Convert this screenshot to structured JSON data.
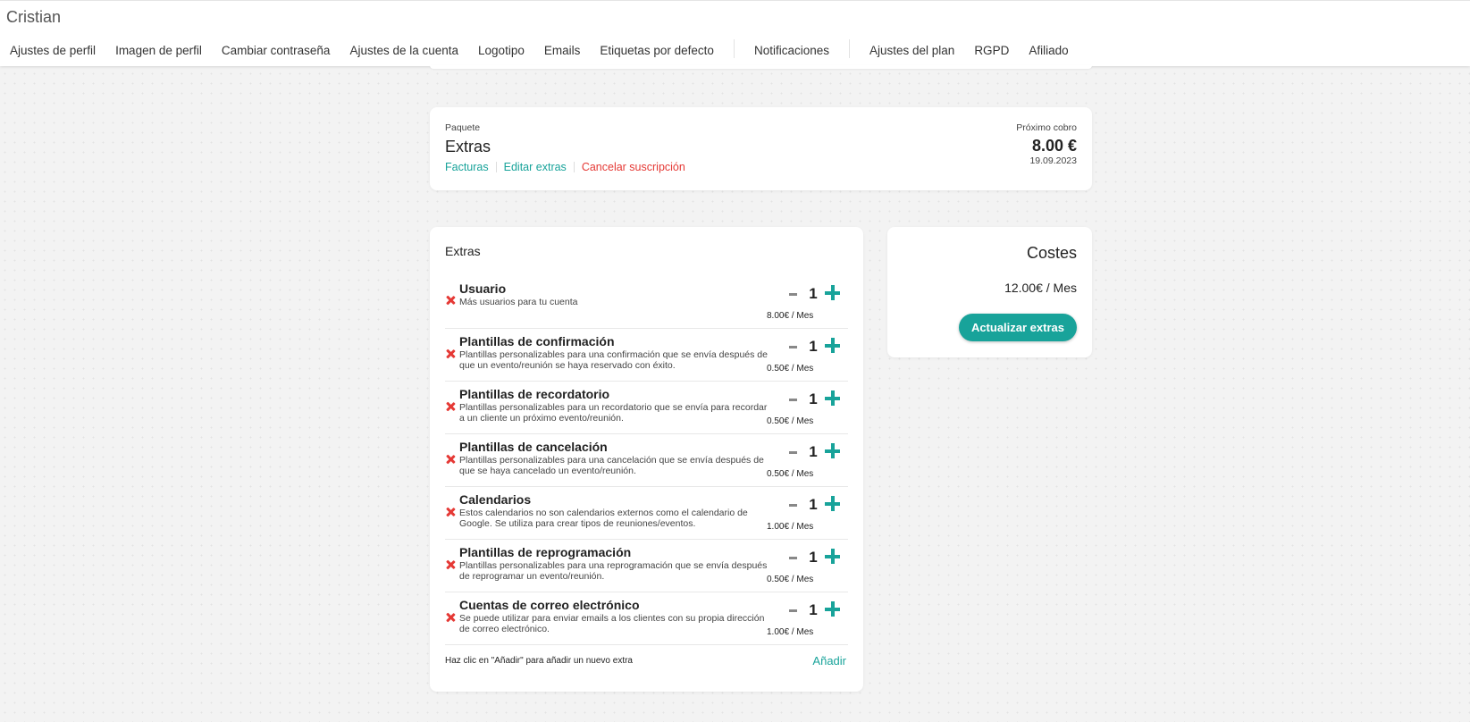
{
  "header": {
    "user_name": "Cristian",
    "tabs": [
      {
        "label": "Ajustes de perfil"
      },
      {
        "label": "Imagen de perfil"
      },
      {
        "label": "Cambiar contraseña"
      },
      {
        "label": "Ajustes de la cuenta"
      },
      {
        "label": "Logotipo"
      },
      {
        "label": "Emails"
      },
      {
        "label": "Etiquetas por defecto"
      },
      {
        "label": "Notificaciones"
      },
      {
        "label": "Ajustes del plan",
        "active": true
      },
      {
        "label": "RGPD"
      },
      {
        "label": "Afiliado"
      }
    ]
  },
  "package": {
    "label": "Paquete",
    "name": "Extras",
    "links": {
      "invoices": "Facturas",
      "edit": "Editar extras",
      "cancel": "Cancelar suscripción"
    },
    "next_label": "Próximo cobro",
    "next_amount": "8.00 €",
    "next_date": "19.09.2023"
  },
  "extras": {
    "title": "Extras",
    "items": [
      {
        "name": "Usuario",
        "description": "Más usuarios para tu cuenta",
        "quantity": "1",
        "price": "8.00€ / Mes"
      },
      {
        "name": "Plantillas de confirmación",
        "description": "Plantillas personalizables para una confirmación que se envía después de que un evento/reunión se haya reservado con éxito.",
        "quantity": "1",
        "price": "0.50€ / Mes"
      },
      {
        "name": "Plantillas de recordatorio",
        "description": "Plantillas personalizables para un recordatorio que se envía para recordar a un cliente un próximo evento/reunión.",
        "quantity": "1",
        "price": "0.50€ / Mes"
      },
      {
        "name": "Plantillas de cancelación",
        "description": "Plantillas personalizables para una cancelación que se envía después de que se haya cancelado un evento/reunión.",
        "quantity": "1",
        "price": "0.50€ / Mes"
      },
      {
        "name": "Calendarios",
        "description": "Estos calendarios no son calendarios externos como el calendario de Google. Se utiliza para crear tipos de reuniones/eventos.",
        "quantity": "1",
        "price": "1.00€ / Mes"
      },
      {
        "name": "Plantillas de reprogramación",
        "description": "Plantillas personalizables para una reprogramación que se envía después de reprogramar un evento/reunión.",
        "quantity": "1",
        "price": "0.50€ / Mes"
      },
      {
        "name": "Cuentas de correo electrónico",
        "description": "Se puede utilizar para enviar emails a los clientes con su propia dirección de correo electrónico.",
        "quantity": "1",
        "price": "1.00€ / Mes"
      }
    ],
    "footer_hint": "Haz clic en \"Añadir\" para añadir un nuevo extra",
    "add_label": "Añadir"
  },
  "costs": {
    "title": "Costes",
    "amount": "12.00€ / Mes",
    "update_button": "Actualizar extras"
  },
  "colors": {
    "accent": "#18a39a",
    "danger": "#e53935"
  },
  "icons": {
    "remove": "close-icon",
    "decrease": "minus-icon",
    "increase": "plus-icon"
  }
}
